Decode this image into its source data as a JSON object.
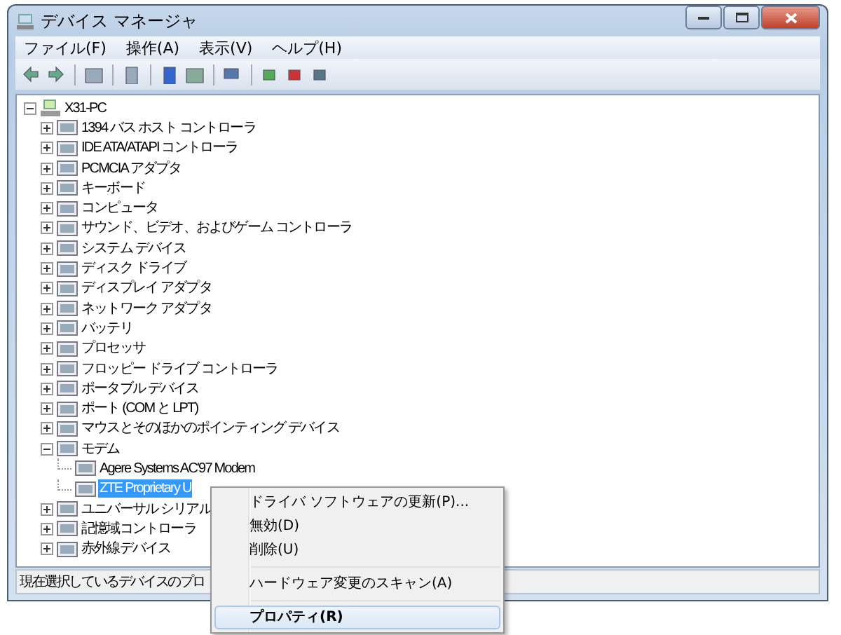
{
  "window": {
    "title": "デバイス マネージャ"
  },
  "menu_bar": [
    {
      "label": "ファイル(F)"
    },
    {
      "label": "操作(A)"
    },
    {
      "label": "表示(V)"
    },
    {
      "label": "ヘルプ(H)"
    }
  ],
  "tree": [
    {
      "label": "X31-PC",
      "expanded": true,
      "selected": false,
      "children": [
        {
          "label": "1394 バス ホスト コントローラ",
          "expanded": false,
          "selected": false
        },
        {
          "label": "IDE ATA/ATAPI コントローラ",
          "expanded": false,
          "selected": false
        },
        {
          "label": "PCMCIA アダプタ",
          "expanded": false,
          "selected": false
        },
        {
          "label": "キーボード",
          "expanded": false,
          "selected": false
        },
        {
          "label": "コンピュータ",
          "expanded": false,
          "selected": false
        },
        {
          "label": "サウンド、ビデオ、およびゲーム コントローラ",
          "expanded": false,
          "selected": false
        },
        {
          "label": "システム デバイス",
          "expanded": false,
          "selected": false
        },
        {
          "label": "ディスク ドライブ",
          "expanded": false,
          "selected": false
        },
        {
          "label": "ディスプレイ アダプタ",
          "expanded": false,
          "selected": false
        },
        {
          "label": "ネットワーク アダプタ",
          "expanded": false,
          "selected": false
        },
        {
          "label": "バッテリ",
          "expanded": false,
          "selected": false
        },
        {
          "label": "プロセッサ",
          "expanded": false,
          "selected": false
        },
        {
          "label": "フロッピー ドライブ コントローラ",
          "expanded": false,
          "selected": false
        },
        {
          "label": "ポータブル デバイス",
          "expanded": false,
          "selected": false
        },
        {
          "label": "ポート (COM と LPT)",
          "expanded": false,
          "selected": false
        },
        {
          "label": "マウスとそのほかのポインティング デバイス",
          "expanded": false,
          "selected": false
        },
        {
          "label": "モデム",
          "expanded": true,
          "selected": false,
          "children": [
            {
              "label": "Agere Systems AC'97 Modem",
              "selected": false
            },
            {
              "label": "ZTE Proprietary U",
              "selected": true
            }
          ]
        },
        {
          "label": "ユニバーサル シリアル",
          "expanded": false,
          "selected": false
        },
        {
          "label": "記憶域コントローラ",
          "expanded": false,
          "selected": false
        },
        {
          "label": "赤外線デバイス",
          "expanded": false,
          "selected": false
        }
      ]
    }
  ],
  "status_bar": "現在選択しているデバイスのプロ",
  "context_menu": [
    {
      "kind": "item",
      "label": "ドライバ ソフトウェアの更新(P)...",
      "selected": false,
      "default": false
    },
    {
      "kind": "item",
      "label": "無効(D)",
      "selected": false,
      "default": false
    },
    {
      "kind": "item",
      "label": "削除(U)",
      "selected": false,
      "default": false
    },
    {
      "kind": "separator"
    },
    {
      "kind": "item",
      "label": "ハードウェア変更のスキャン(A)",
      "selected": false,
      "default": false
    },
    {
      "kind": "separator"
    },
    {
      "kind": "item",
      "label": "プロパティ(R)",
      "selected": true,
      "default": true
    }
  ]
}
